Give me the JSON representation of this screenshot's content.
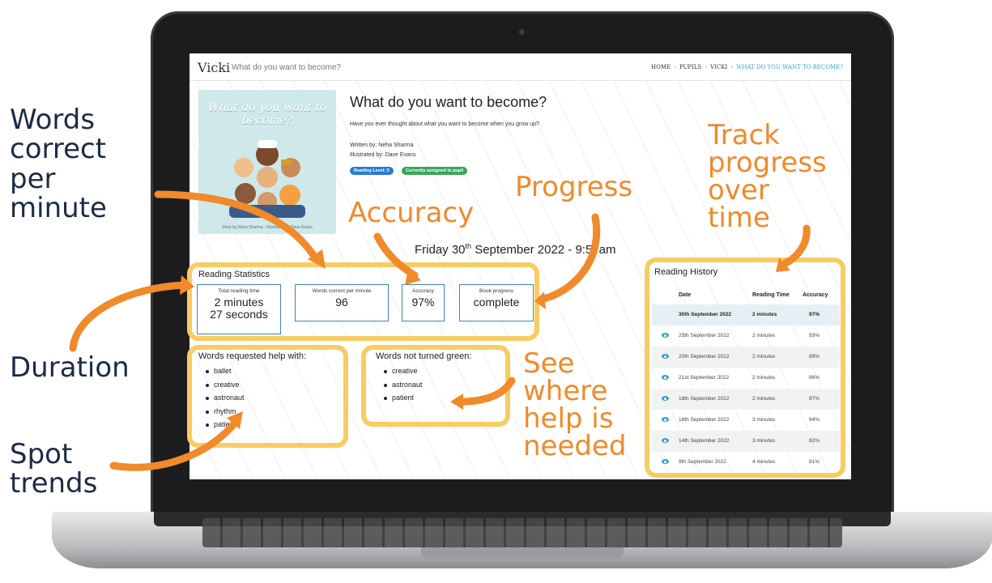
{
  "app": {
    "user_name": "Vicki",
    "page_subtitle": "What do you want to become?",
    "breadcrumbs": [
      "HOME",
      "PUPILS",
      "VICKI",
      "WHAT DO YOU WANT TO BECOME?"
    ],
    "breadcrumb_separator": "›"
  },
  "book": {
    "cover_title": "What do you want to become?",
    "cover_credit": "Story by Neha Sharma · Illustrated by Dave Evans",
    "title": "What do you want to become?",
    "description": "Have you ever thought about what you want to become when you grow up?",
    "written_by": "Written by: Neha Sharma",
    "illustrated_by": "Illustrated by: Dave Evans",
    "badges": {
      "level": "Reading Level: 3",
      "assigned": "Currently assigned to pupil"
    }
  },
  "session": {
    "date_prefix": "Friday 30",
    "date_suffix": "th",
    "date_rest": " September 2022 - 9:57am"
  },
  "statistics": {
    "title": "Reading Statistics",
    "total_time": {
      "label": "Total reading time",
      "line1": "2 minutes",
      "line2": "27 seconds"
    },
    "wcpm": {
      "label": "Words correct per minute",
      "value": "96"
    },
    "accuracy": {
      "label": "Accuracy",
      "value": "97%"
    },
    "progress": {
      "label": "Book progress",
      "value": "complete"
    }
  },
  "help_words": {
    "title": "Words requested help with:",
    "items": [
      "ballet",
      "creative",
      "astronaut",
      "rhythm",
      "patient"
    ]
  },
  "not_green_words": {
    "title": "Words not turned green:",
    "items": [
      "creative",
      "astronaut",
      "patient"
    ]
  },
  "history": {
    "title": "Reading History",
    "columns": [
      "Date",
      "Reading Time",
      "Accuracy"
    ],
    "rows": [
      {
        "date": "30th September 2022",
        "time": "2 minutes",
        "accuracy": "97%"
      },
      {
        "date": "25th September 2022",
        "time": "2 minutes",
        "accuracy": "93%"
      },
      {
        "date": "20th September 2022",
        "time": "2 minutes",
        "accuracy": "89%"
      },
      {
        "date": "21st September 2022",
        "time": "2 minutes",
        "accuracy": "86%"
      },
      {
        "date": "18th September 2022",
        "time": "2 minutes",
        "accuracy": "87%"
      },
      {
        "date": "16th September 2022",
        "time": "3 minutes",
        "accuracy": "84%"
      },
      {
        "date": "14th September 2022",
        "time": "3 minutes",
        "accuracy": "82%"
      },
      {
        "date": "9th September 2022",
        "time": "4 minutes",
        "accuracy": "81%"
      }
    ]
  },
  "annotations": {
    "wcpm": [
      "Words",
      "correct",
      "per",
      "minute"
    ],
    "duration": "Duration",
    "trends": [
      "Spot",
      "trends"
    ],
    "accuracy": "Accuracy",
    "progress": "Progress",
    "track": [
      "Track",
      "progress",
      "over",
      "time"
    ],
    "help": [
      "See",
      "where",
      "help is",
      "needed"
    ]
  },
  "colors": {
    "highlight": "#f7cc63",
    "callout": "#f08a2a",
    "side_label": "#1c2b45",
    "stat_border": "#3e86b3",
    "eye_icon": "#3a9fd1"
  }
}
